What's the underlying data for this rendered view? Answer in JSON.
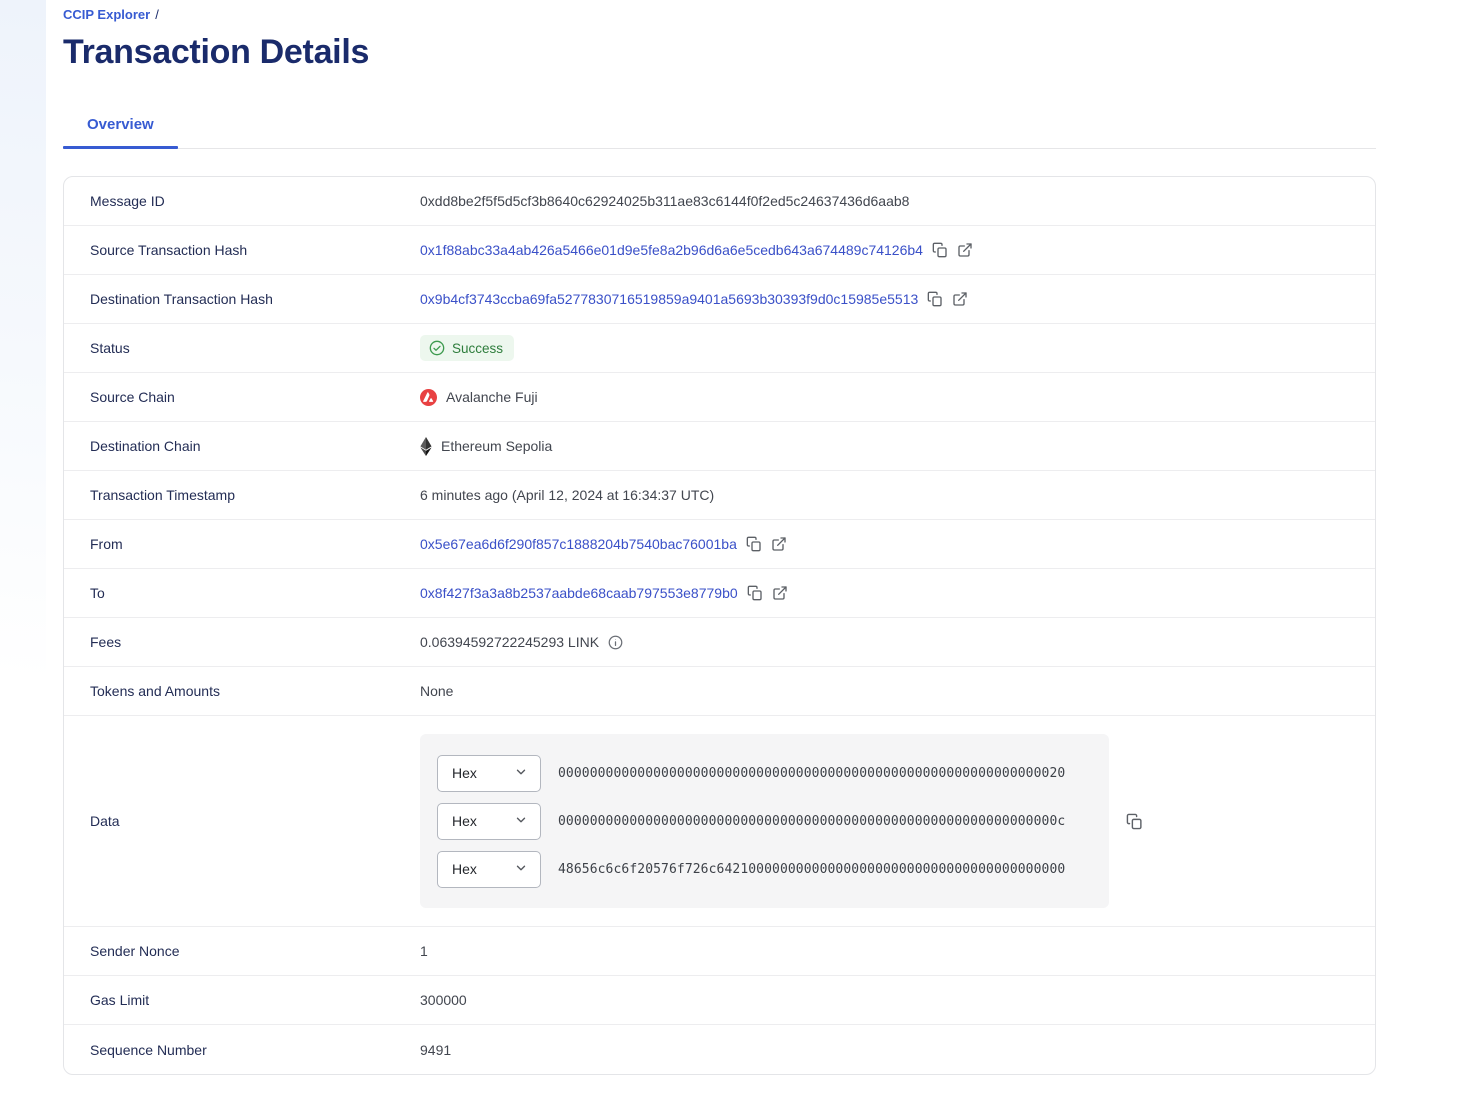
{
  "header": {
    "breadcrumb": "CCIP Explorer",
    "breadcrumb_separator": "/",
    "title": "Transaction Details",
    "tab_overview": "Overview"
  },
  "rows": {
    "message_id": {
      "label": "Message ID",
      "value": "0xdd8be2f5f5d5cf3b8640c62924025b311ae83c6144f0f2ed5c24637436d6aab8"
    },
    "source_tx_hash": {
      "label": "Source Transaction Hash",
      "value": "0x1f88abc33a4ab426a5466e01d9e5fe8a2b96d6a6e5cedb643a674489c74126b4"
    },
    "dest_tx_hash": {
      "label": "Destination Transaction Hash",
      "value": "0x9b4cf3743ccba69fa5277830716519859a9401a5693b30393f9d0c15985e5513"
    },
    "status": {
      "label": "Status",
      "value": "Success"
    },
    "source_chain": {
      "label": "Source Chain",
      "value": "Avalanche Fuji"
    },
    "dest_chain": {
      "label": "Destination Chain",
      "value": "Ethereum Sepolia"
    },
    "timestamp": {
      "label": "Transaction Timestamp",
      "value": "6 minutes ago (April 12, 2024 at 16:34:37 UTC)"
    },
    "from": {
      "label": "From",
      "value": "0x5e67ea6d6f290f857c1888204b7540bac76001ba"
    },
    "to": {
      "label": "To",
      "value": "0x8f427f3a3a8b2537aabde68caab797553e8779b0"
    },
    "fees": {
      "label": "Fees",
      "value": "0.06394592722245293 LINK"
    },
    "tokens": {
      "label": "Tokens and Amounts",
      "value": "None"
    },
    "data": {
      "label": "Data"
    },
    "sender_nonce": {
      "label": "Sender Nonce",
      "value": "1"
    },
    "gas_limit": {
      "label": "Gas Limit",
      "value": "300000"
    },
    "sequence_number": {
      "label": "Sequence Number",
      "value": "9491"
    }
  },
  "data_rows": [
    {
      "format": "Hex",
      "value": "0000000000000000000000000000000000000000000000000000000000000020"
    },
    {
      "format": "Hex",
      "value": "000000000000000000000000000000000000000000000000000000000000000c"
    },
    {
      "format": "Hex",
      "value": "48656c6c6f20576f726c64210000000000000000000000000000000000000000"
    }
  ],
  "icons": {
    "copy": "copy-icon",
    "external_link": "external-link-icon",
    "success_check": "check-circle-icon",
    "avalanche": "avalanche-logo-icon",
    "ethereum": "ethereum-logo-icon",
    "info": "info-icon",
    "chevron_down": "chevron-down-icon"
  },
  "colors": {
    "brand_blue": "#375bd2",
    "heading_navy": "#1a2b6b",
    "link_blue": "#3a50c8",
    "success_text": "#2e7d3c",
    "success_bg": "#edf7ee",
    "avalanche_red": "#e84142"
  }
}
